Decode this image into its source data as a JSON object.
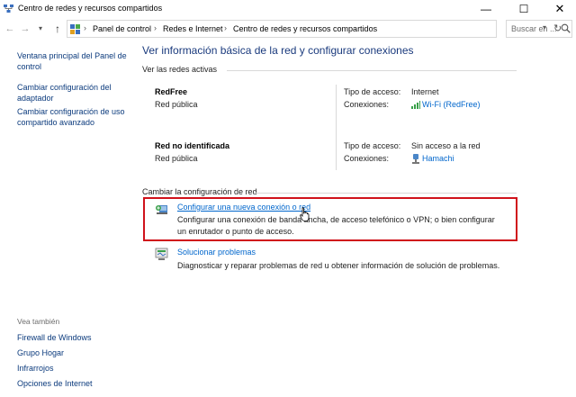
{
  "window": {
    "title": "Centro de redes y recursos compartidos",
    "minimize": "—",
    "maximize": "☐",
    "close": "✕"
  },
  "address": {
    "crumbs": [
      "Panel de control",
      "Redes e Internet",
      "Centro de redes y recursos compartidos"
    ],
    "search_placeholder": "Buscar en ..."
  },
  "sidebar": {
    "links": [
      "Ventana principal del Panel de control",
      "Cambiar configuración del adaptador",
      "Cambiar configuración de uso compartido avanzado"
    ],
    "see_also_heading": "Vea también",
    "see_also": [
      "Firewall de Windows",
      "Grupo Hogar",
      "Infrarrojos",
      "Opciones de Internet"
    ]
  },
  "main": {
    "title": "Ver información básica de la red y configurar conexiones",
    "active_networks_label": "Ver las redes activas",
    "networks": [
      {
        "name": "RedFree",
        "type": "Red pública",
        "access_label": "Tipo de acceso:",
        "access_value": "Internet",
        "connections_label": "Conexiones:",
        "connection": "Wi-Fi (RedFree)",
        "connection_icon": "wifi-signal-icon"
      },
      {
        "name": "Red no identificada",
        "type": "Red pública",
        "access_label": "Tipo de acceso:",
        "access_value": "Sin acceso a la red",
        "connections_label": "Conexiones:",
        "connection": "Hamachi",
        "connection_icon": "network-adapter-icon"
      }
    ],
    "change_settings_label": "Cambiar la configuración de red",
    "tasks": [
      {
        "link": "Configurar una nueva conexión o red",
        "description": "Configurar una conexión de banda ancha, de acceso telefónico o VPN; o bien configurar un enrutador o punto de acceso.",
        "icon": "new-connection-icon",
        "highlighted": true
      },
      {
        "link": "Solucionar problemas",
        "description": "Diagnosticar y reparar problemas de red u obtener información de solución de problemas.",
        "icon": "troubleshoot-icon",
        "highlighted": false
      }
    ]
  },
  "colors": {
    "link": "#0066cc",
    "sidebar_link": "#0c3b7d",
    "title": "#1a3a7d",
    "highlight_border": "#d0121b"
  }
}
